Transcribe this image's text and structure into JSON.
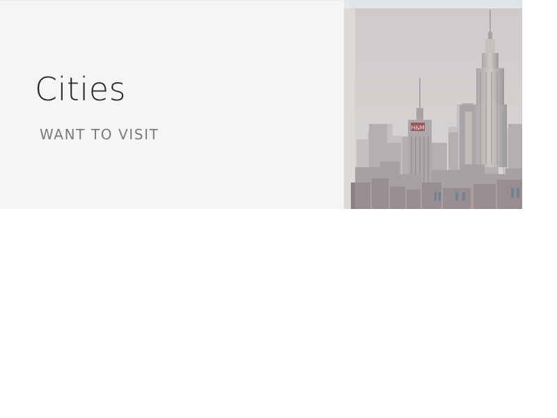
{
  "board": {
    "title": "Cities",
    "subtitle": "WANT TO VISIT"
  },
  "thumbnail": {
    "description_icon": "city-skyline-image",
    "sign_text": "H&M"
  },
  "colors": {
    "card_background": "#f5f5f5",
    "title_color": "#26262b",
    "subtitle_color": "#7b7b7f",
    "sky_color": "#c9c5c4"
  }
}
